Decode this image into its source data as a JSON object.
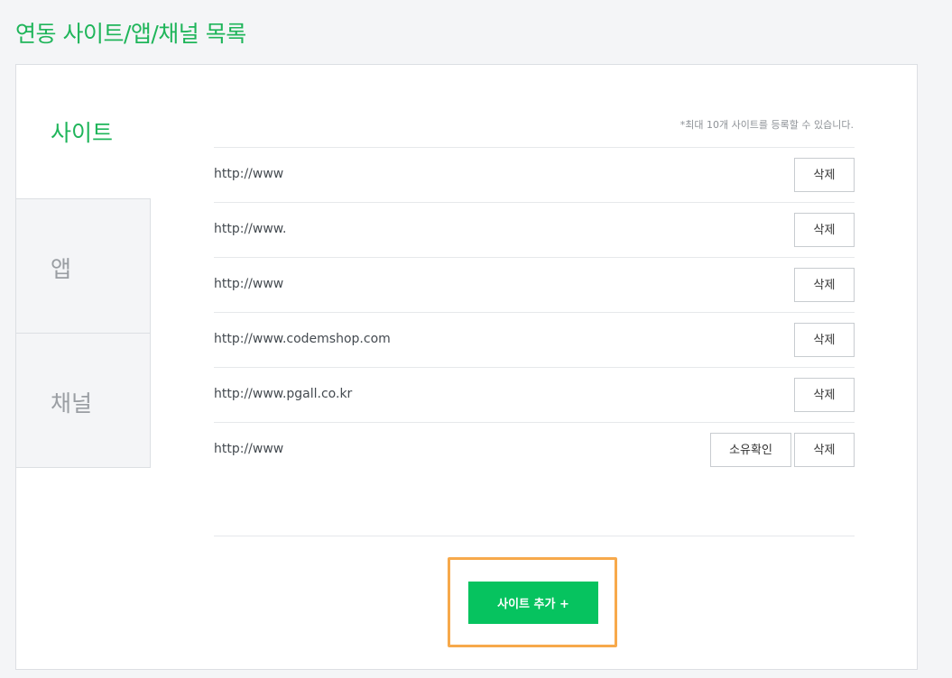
{
  "page": {
    "title": "연동 사이트/앱/채널 목록"
  },
  "tabs": [
    {
      "label": "사이트",
      "active": true
    },
    {
      "label": "앱",
      "active": false
    },
    {
      "label": "채널",
      "active": false
    }
  ],
  "notice": "*최대 10개 사이트를 등록할 수 있습니다.",
  "sites": [
    {
      "url": "http://www",
      "delete_label": "삭제"
    },
    {
      "url": "http://www.",
      "delete_label": "삭제"
    },
    {
      "url": "http://www",
      "delete_label": "삭제"
    },
    {
      "url": "http://www.codemshop.com",
      "delete_label": "삭제"
    },
    {
      "url": "http://www.pgall.co.kr",
      "delete_label": "삭제"
    },
    {
      "url": "http://www",
      "delete_label": "삭제",
      "verify_label": "소유확인"
    }
  ],
  "add_button_label": "사이트 추가 +",
  "colors": {
    "accent": "#1fb55a",
    "button_green": "#06c35f",
    "highlight": "#f7a94b"
  }
}
